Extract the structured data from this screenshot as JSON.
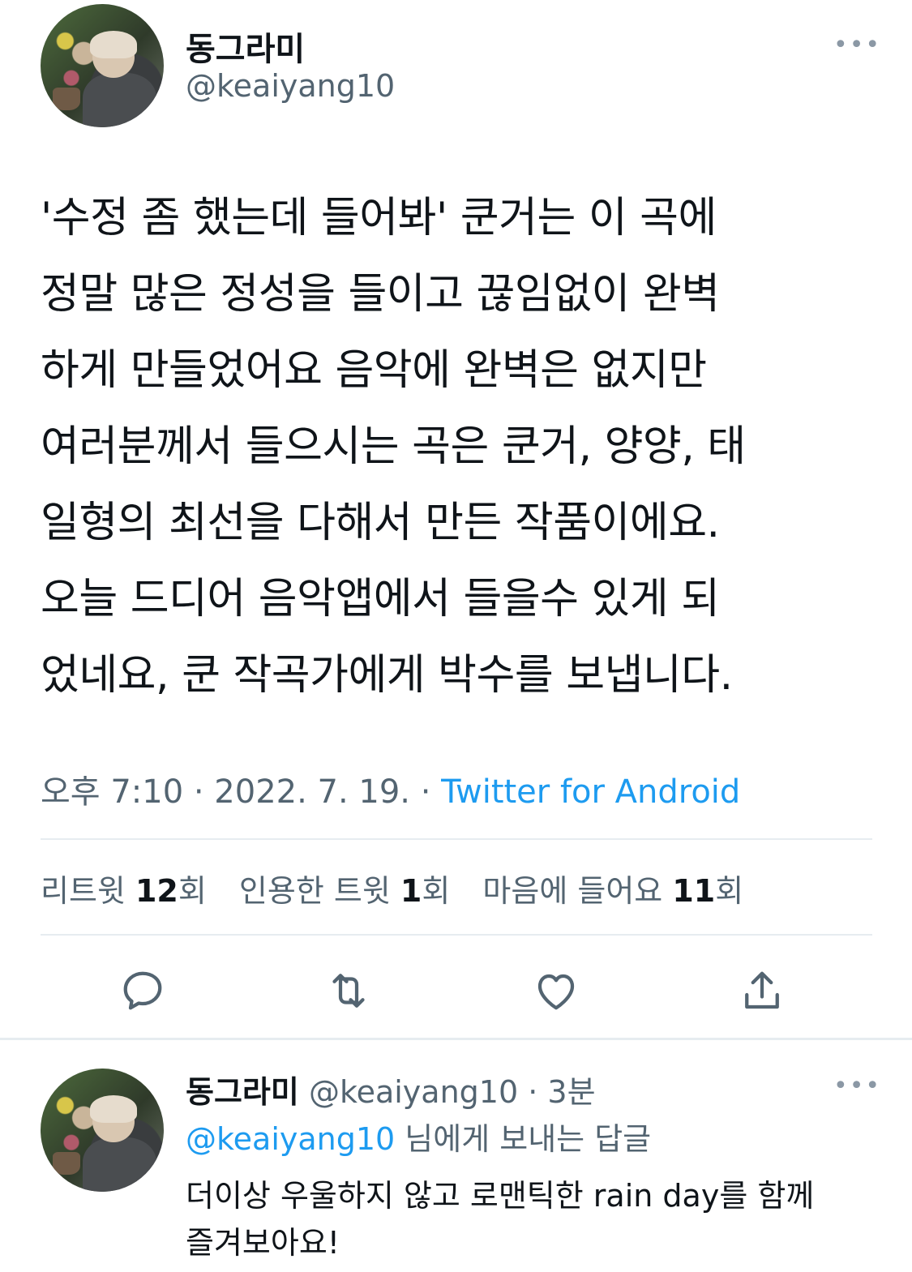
{
  "main_tweet": {
    "display_name": "동그라미",
    "handle": "@keaiyang10",
    "more_label": "•••",
    "text": "'수정 좀 했는데 들어봐' 쿤거는 이 곡에\n정말 많은 정성을 들이고 끊임없이 완벽\n하게 만들었어요 음악에 완벽은 없지만\n여러분께서 들으시는 곡은 쿤거, 양양, 태\n일형의 최선을 다해서 만든 작품이에요.\n오늘 드디어 음악앱에서 들을수 있게 되\n었네요, 쿤 작곡가에게 박수를 보냅니다.",
    "time": "오후 7:10",
    "separator": " · ",
    "date": "2022. 7. 19.",
    "source": "Twitter for Android"
  },
  "stats": {
    "retweets_label": "리트윗 ",
    "retweets_count": "12",
    "retweets_suffix": "회",
    "quotes_label": "인용한 트윗 ",
    "quotes_count": "1",
    "quotes_suffix": "회",
    "likes_label": "마음에 들어요 ",
    "likes_count": "11",
    "likes_suffix": "회"
  },
  "actions": {
    "reply_icon": "reply-icon",
    "retweet_icon": "retweet-icon",
    "like_icon": "heart-icon",
    "share_icon": "share-icon"
  },
  "reply_tweet": {
    "display_name": "동그라미",
    "handle": "@keaiyang10",
    "time": "· 3분",
    "more_label": "•••",
    "replying_to_mention": "@keaiyang10",
    "replying_to_suffix": " 님에게 보내는 답글",
    "text": "더이상 우울하지 않고 로맨틱한 rain day를 함께\n즐겨보아요!"
  },
  "colors": {
    "accent": "#1d9bf0",
    "secondary_text": "#536471",
    "primary_text": "#0f1419",
    "divider": "#e6ecf0"
  }
}
